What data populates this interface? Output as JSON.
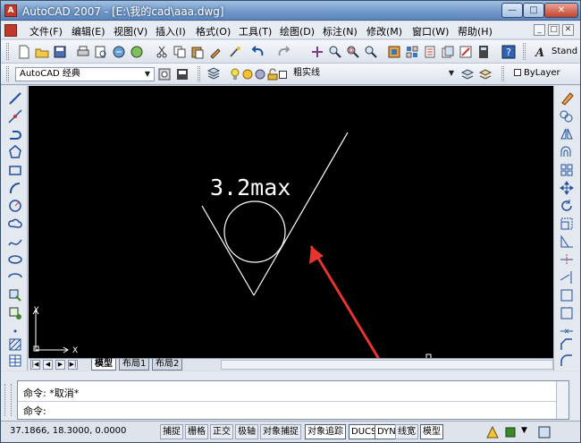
{
  "window": {
    "title": "AutoCAD 2007 - [E:\\我的cad\\aaa.dwg]",
    "min_glyph": "—",
    "max_glyph": "□",
    "close_glyph": "✕"
  },
  "menu": {
    "items": [
      "文件(F)",
      "编辑(E)",
      "视图(V)",
      "插入(I)",
      "格式(O)",
      "工具(T)",
      "绘图(D)",
      "标注(N)",
      "修改(M)",
      "窗口(W)",
      "帮助(H)"
    ],
    "doc_controls": [
      "_",
      "□",
      "✕"
    ]
  },
  "toolbar1": {
    "text_style_label": "Stand"
  },
  "toolbar2": {
    "workspace": "AutoCAD 经典",
    "layer": "粗实线",
    "color": "ByLayer"
  },
  "drawing": {
    "roughness_text": "3.2max",
    "ucs_x_label": "X",
    "ucs_y_label": "Y",
    "colors": {
      "background": "#000000",
      "lines": "#ffffff",
      "annotation_arrow": "#e8342f"
    }
  },
  "layout_tabs": [
    "模型",
    "布局1",
    "布局2"
  ],
  "command": {
    "line1": "命令: *取消*",
    "line2": "命令:"
  },
  "status": {
    "coords": "37.1866, 18.3000, 0.0000",
    "toggles": [
      {
        "label": "捕捉",
        "on": false
      },
      {
        "label": "栅格",
        "on": false
      },
      {
        "label": "正交",
        "on": false
      },
      {
        "label": "极轴",
        "on": false
      },
      {
        "label": "对象捕捉",
        "on": false
      },
      {
        "label": "对象追踪",
        "on": true
      },
      {
        "label": "DUCS",
        "on": true
      },
      {
        "label": "DYN",
        "on": true
      },
      {
        "label": "线宽",
        "on": false
      },
      {
        "label": "模型",
        "on": true
      }
    ]
  },
  "icons": {
    "toolbar1": [
      "new-icon",
      "open-icon",
      "save-icon",
      "print-icon",
      "print-preview-icon",
      "publish-icon",
      "3d-dwf-icon",
      "cut-icon",
      "copy-icon",
      "paste-icon",
      "match-properties-icon",
      "undo-icon",
      "redo-icon",
      "pan-icon",
      "zoom-realtime-icon",
      "zoom-window-icon",
      "zoom-previous-icon",
      "properties-icon",
      "design-center-icon",
      "tool-palettes-icon",
      "sheet-set-icon",
      "markup-icon",
      "calculator-icon",
      "help-icon",
      "text-style-icon"
    ],
    "left": [
      "line-icon",
      "construction-line-icon",
      "polyline-icon",
      "polygon-icon",
      "rectangle-icon",
      "arc-icon",
      "circle-icon",
      "revision-cloud-icon",
      "spline-icon",
      "ellipse-icon",
      "ellipse-arc-icon",
      "insert-block-icon",
      "make-block-icon",
      "point-icon",
      "hatch-icon",
      "table-icon"
    ],
    "right": [
      "erase-icon",
      "copy-object-icon",
      "mirror-icon",
      "offset-icon",
      "array-icon",
      "move-icon",
      "rotate-icon",
      "scale-icon",
      "stretch-icon",
      "trim-icon",
      "extend-icon",
      "break-at-point-icon",
      "break-icon",
      "join-icon",
      "chamfer-icon",
      "fillet-icon"
    ]
  }
}
